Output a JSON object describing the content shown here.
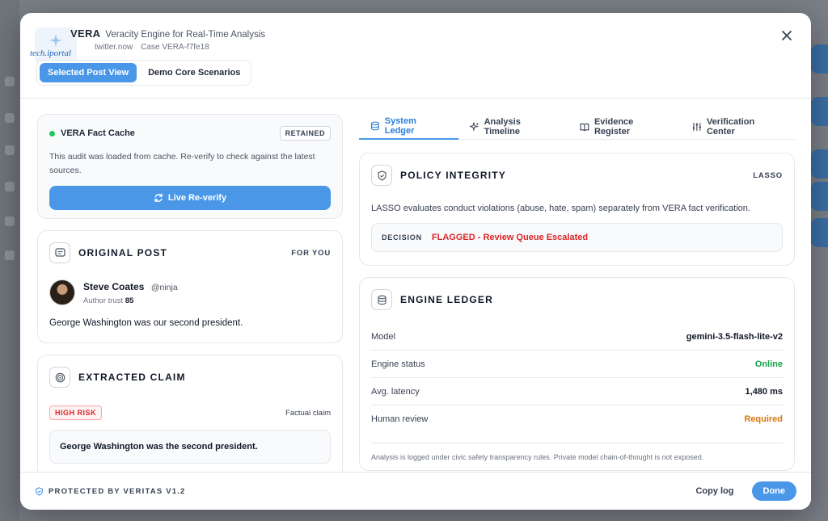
{
  "header": {
    "brand_name": "VERA",
    "brand_subtitle": "Veracity Engine for Real-Time Analysis",
    "source": "twitter.now",
    "case_id": "Case VERA-f7fe18",
    "watermark": "tech.iportal",
    "view_toggle": [
      "Selected Post View",
      "Demo Core Scenarios"
    ]
  },
  "cache": {
    "title": "VERA Fact Cache",
    "badge": "RETAINED",
    "text": "This audit was loaded from cache. Re-verify to check against the latest sources.",
    "button": "Live Re-verify"
  },
  "original_post": {
    "title": "ORIGINAL POST",
    "tag": "FOR YOU",
    "author_name": "Steve Coates",
    "author_handle": "@ninja",
    "trust_label": "Author trust",
    "trust_value": "85",
    "text": "George Washington was our second president."
  },
  "extracted_claim": {
    "title": "EXTRACTED CLAIM",
    "risk": "HIGH RISK",
    "type": "Factual claim",
    "claim": "George Washington was the second president."
  },
  "tabs": [
    "System Ledger",
    "Analysis Timeline",
    "Evidence Register",
    "Verification Center"
  ],
  "policy": {
    "title": "POLICY INTEGRITY",
    "tag": "LASSO",
    "text": "LASSO evaluates conduct violations (abuse, hate, spam) separately from VERA fact verification.",
    "decision_label": "DECISION",
    "decision_value": "FLAGGED - Review Queue Escalated"
  },
  "engine": {
    "title": "ENGINE LEDGER",
    "rows": [
      {
        "key": "Model",
        "value": "gemini-3.5-flash-lite-v2"
      },
      {
        "key": "Engine status",
        "value": "Online"
      },
      {
        "key": "Avg. latency",
        "value": "1,480 ms"
      },
      {
        "key": "Human review",
        "value": "Required"
      }
    ],
    "note": "Analysis is logged under civic safety transparency rules. Private model chain-of-thought is not exposed."
  },
  "footer": {
    "protected": "PROTECTED BY VERITAS V1.2",
    "copy": "Copy log",
    "done": "Done"
  },
  "colors": {
    "accent": "#4a97e8",
    "danger": "#dc2626",
    "success": "#16a34a",
    "warning": "#d97706"
  }
}
